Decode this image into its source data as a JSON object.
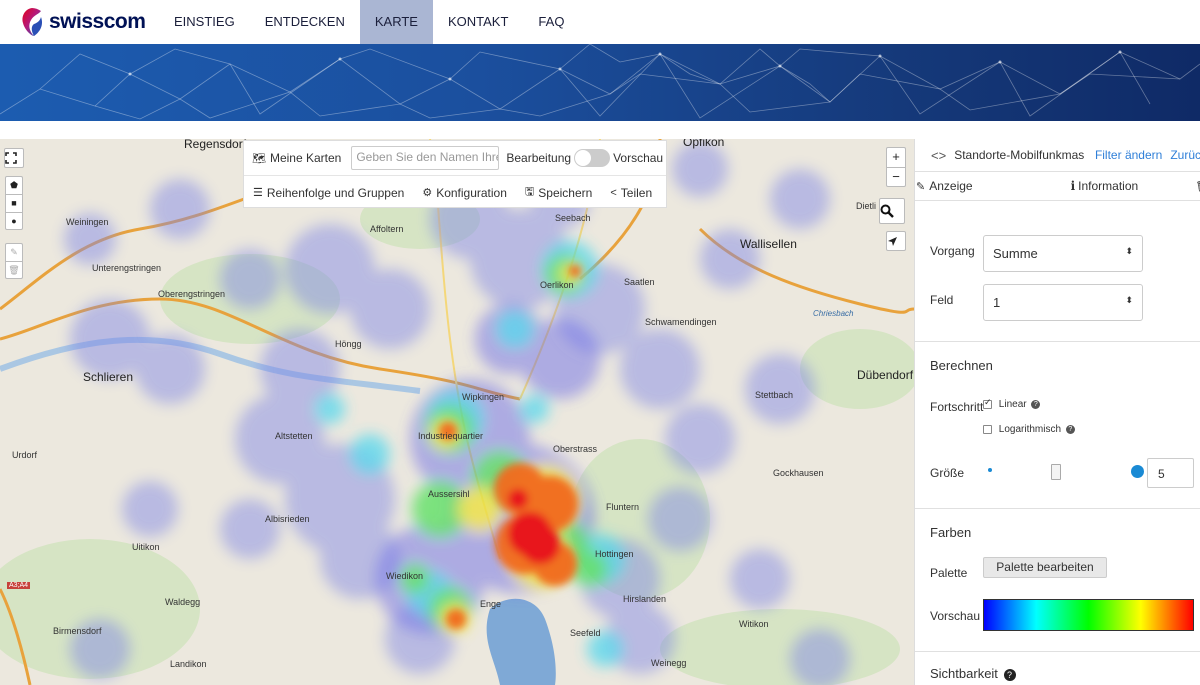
{
  "brand": {
    "name": "swisscom"
  },
  "nav": {
    "items": [
      {
        "label": "EINSTIEG"
      },
      {
        "label": "ENTDECKEN"
      },
      {
        "label": "KARTE",
        "active": true
      },
      {
        "label": "KONTAKT"
      },
      {
        "label": "FAQ"
      }
    ]
  },
  "map": {
    "places": {
      "regensdorf": "Regensdorf",
      "opfikon": "Opfikon",
      "weiningen": "Weiningen",
      "affoltern": "Affoltern",
      "seebach": "Seebach",
      "wallisellen": "Wallisellen",
      "dietlikon": "Dietli",
      "unterengstringen": "Unterengstringen",
      "oberengstringen": "Oberengstringen",
      "oerlikon": "Oerlikon",
      "saatlen": "Saatlen",
      "schwamendingen": "Schwamendingen",
      "hongg": "Höngg",
      "schlieren": "Schlieren",
      "stettbach": "Stettbach",
      "dubendorf": "Dübendorf",
      "wipkingen": "Wipkingen",
      "industriequartier": "Industriequartier",
      "altstetten": "Altstetten",
      "oberstrass": "Oberstrass",
      "urdorf": "Urdorf",
      "gockhausen": "Gockhausen",
      "aussersihl": "Aussersihl",
      "fluntern": "Fluntern",
      "albisrieden": "Albisrieden",
      "uitikon": "Uitikon",
      "hottingen": "Hottingen",
      "wiedikon": "Wiedikon",
      "hirslanden": "Hirslanden",
      "waldegg": "Waldegg",
      "witikon": "Witikon",
      "enge": "Enge",
      "seefeld": "Seefeld",
      "birmensdorf": "Birmensdorf",
      "landikon": "Landikon",
      "weinegg": "Weinegg",
      "road_a3a4": "A3;A4",
      "chriesbach": "Chriesbach"
    },
    "controls": {
      "zoom_in": "+",
      "zoom_out": "−"
    }
  },
  "toolbar": {
    "my_maps": "Meine Karten",
    "name_placeholder": "Geben Sie den Namen Ihre",
    "editing": "Bearbeitung",
    "preview": "Vorschau",
    "order_groups": "Reihenfolge und Gruppen",
    "configuration": "Konfiguration",
    "save": "Speichern",
    "share": "Teilen"
  },
  "panel": {
    "layer_title": "Standorte-Mobilfunkmas",
    "filter_change": "Filter ändern",
    "back": "Zurüc",
    "tab_display": "Anzeige",
    "tab_info": "Information",
    "operation_label": "Vorgang",
    "operation_value": "Summe",
    "field_label": "Feld",
    "field_value": "1",
    "calc_title": "Berechnen",
    "progress_label": "Fortschritt",
    "linear": "Linear",
    "logarithmic": "Logarithmisch",
    "size_label": "Größe",
    "size_value": "5",
    "colors_title": "Farben",
    "palette_label": "Palette",
    "palette_button": "Palette bearbeiten",
    "preview_label": "Vorschau",
    "visibility_title": "Sichtbarkeit"
  },
  "colors": {
    "nav_active": "#aab6d3",
    "brand_navy": "#001155",
    "link": "#2f7fd8",
    "accent_blue": "#1a8ad4"
  }
}
